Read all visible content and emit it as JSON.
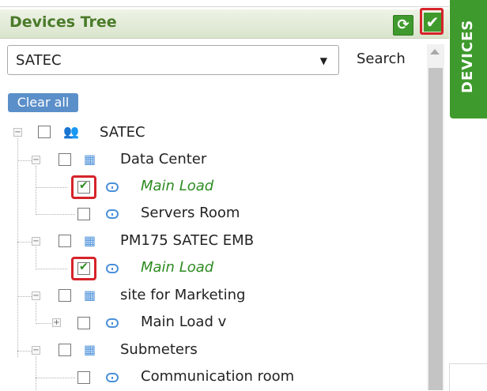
{
  "panel": {
    "title": "Devices Tree",
    "refresh_icon": "refresh-icon",
    "apply_icon": "check-icon",
    "search_label": "Search",
    "clear_label": "Clear all",
    "side_tab_label": "DEVICES"
  },
  "selector": {
    "value": "SATEC",
    "arrow": "▼"
  },
  "tree": {
    "root": {
      "label": "SATEC",
      "icon": "group-icon",
      "checked": false
    },
    "nodes": [
      {
        "label": "Data Center",
        "icon": "building-icon",
        "checked": false,
        "level": 1
      },
      {
        "label": "Main Load",
        "icon": "meter-icon",
        "checked": true,
        "level": 2
      },
      {
        "label": "Servers Room",
        "icon": "meter-icon",
        "checked": false,
        "level": 2
      },
      {
        "label": "PM175 SATEC EMB",
        "icon": "building-icon",
        "checked": false,
        "level": 1
      },
      {
        "label": "Main Load",
        "icon": "meter-icon",
        "checked": true,
        "level": 2
      },
      {
        "label": "site for Marketing",
        "icon": "building-icon",
        "checked": false,
        "level": 1
      },
      {
        "label": "Main Load v",
        "icon": "meter-icon",
        "checked": false,
        "level": 2
      },
      {
        "label": "Submeters",
        "icon": "building-icon",
        "checked": false,
        "level": 1
      },
      {
        "label": "Communication room",
        "icon": "meter-icon",
        "checked": false,
        "level": 2
      }
    ]
  }
}
